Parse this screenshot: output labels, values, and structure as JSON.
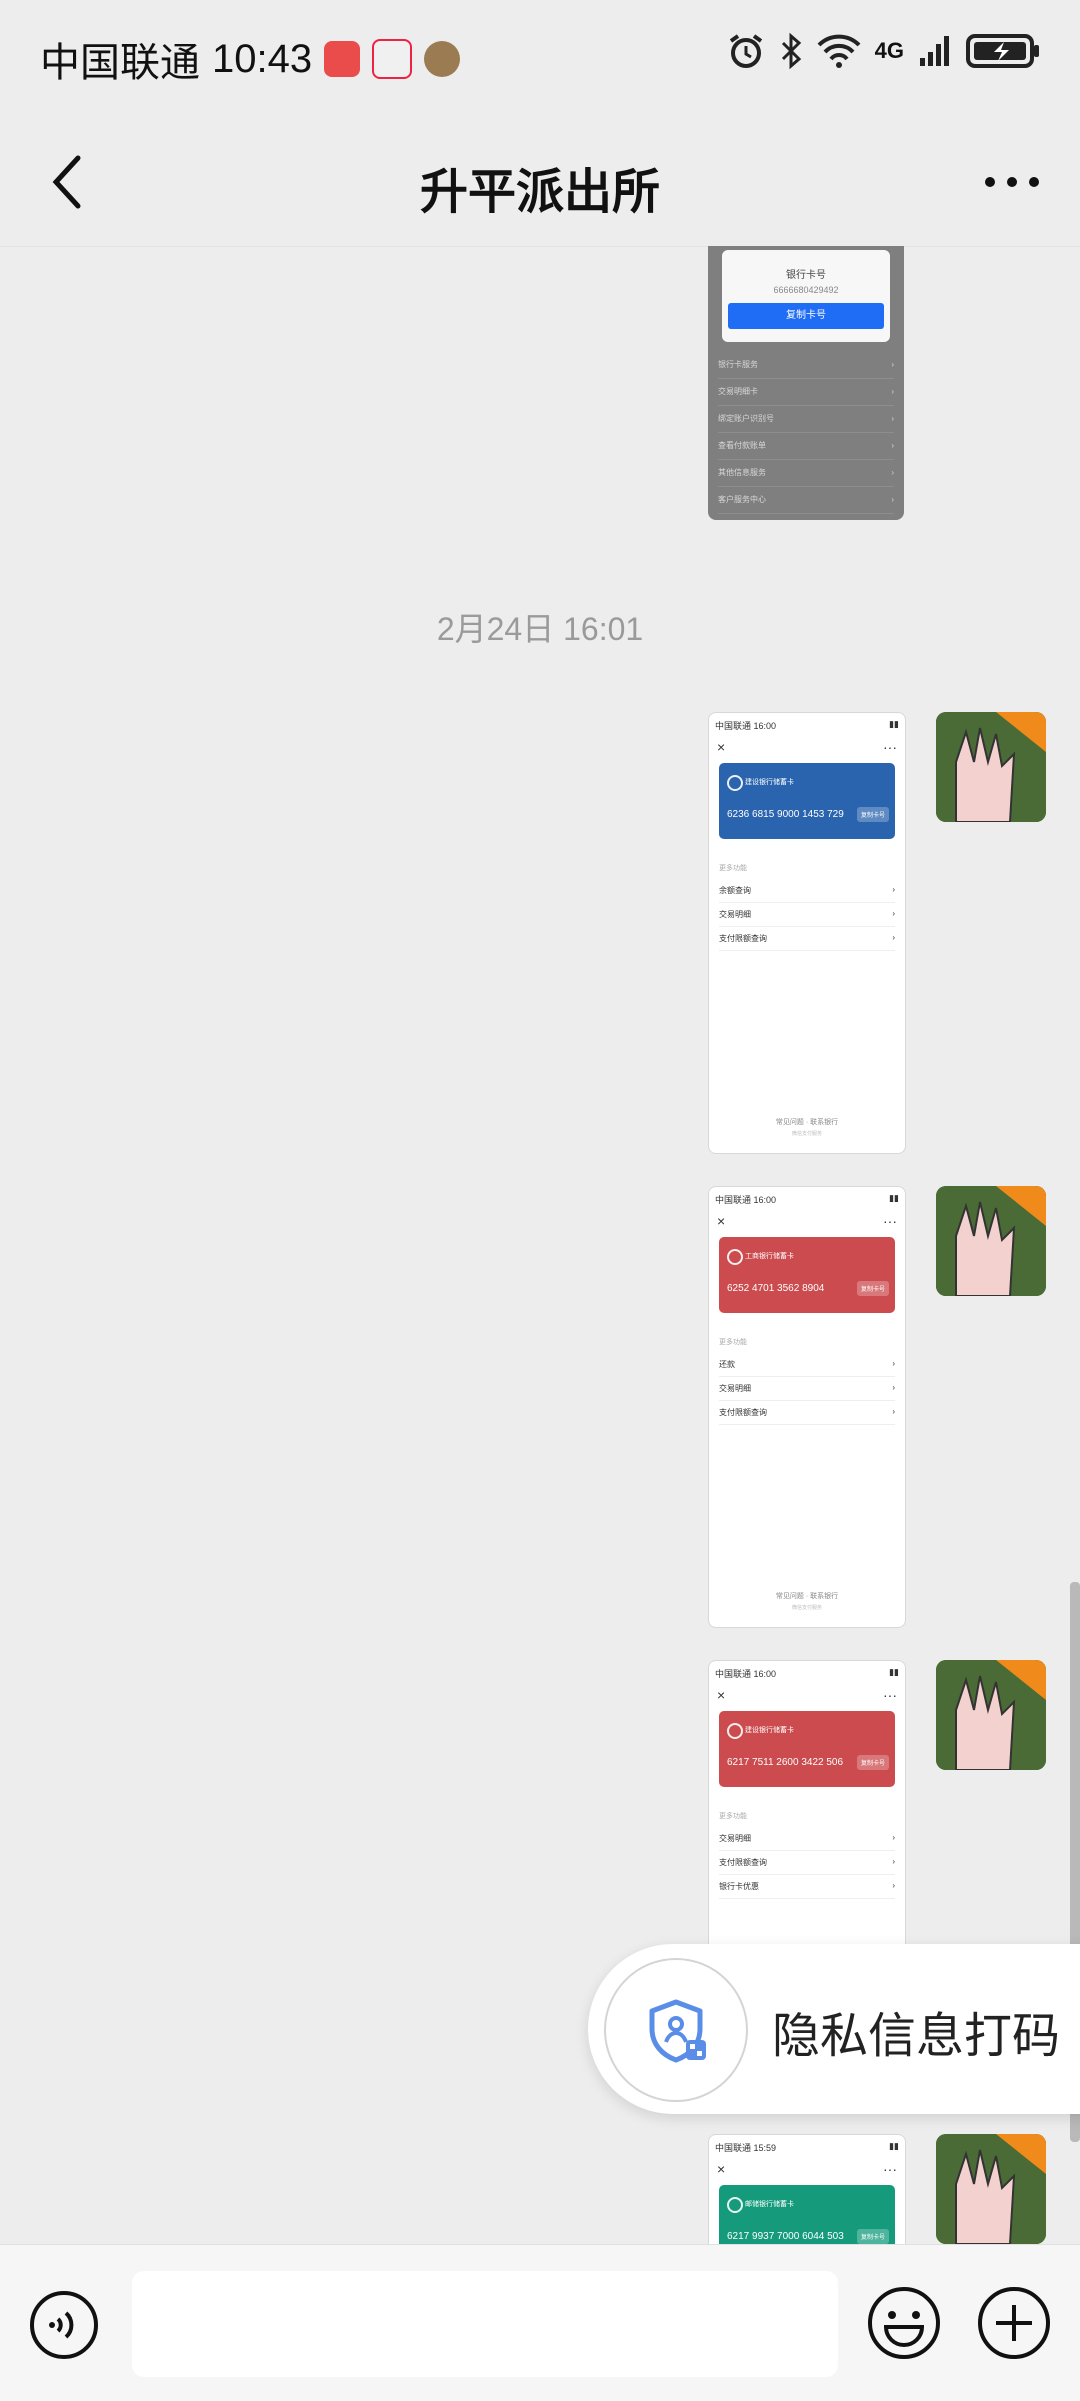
{
  "status_bar": {
    "carrier": "中国联通",
    "time": "10:43",
    "network": "4G"
  },
  "header": {
    "title": "升平派出所"
  },
  "chat": {
    "timestamp": "2月24日 16:01",
    "blurred_shot": {
      "popup_title": "银行卡号",
      "popup_number": "6666680429492",
      "popup_button": "复制卡号",
      "rows": [
        "银行卡服务",
        "交易明细卡",
        "绑定账户识别号",
        "查看付款账单",
        "其他信息服务",
        "客户服务中心"
      ]
    },
    "messages": [
      {
        "mini_time": "中国联通 16:00",
        "bank": "建设银行储蓄卡",
        "card_number": "6236 6815 9000 1453 729",
        "card_button": "复制卡号",
        "color": "#2a63ae",
        "section": "更多功能",
        "rows": [
          "余额查询",
          "交易明细",
          "支付限额查询"
        ],
        "footer": "常见问题 · 联系银行",
        "footer_sub": "微信支付服务"
      },
      {
        "mini_time": "中国联通 16:00",
        "bank": "工商银行储蓄卡",
        "card_number": "6252 4701 3562 8904",
        "card_button": "复制卡号",
        "color": "#cc4b4e",
        "section": "更多功能",
        "rows": [
          "还款",
          "交易明细",
          "支付限额查询"
        ],
        "footer": "常见问题 · 联系银行",
        "footer_sub": "微信支付服务"
      },
      {
        "mini_time": "中国联通 16:00",
        "bank": "建设银行储蓄卡",
        "card_number": "6217 7511 2600 3422 506",
        "card_button": "复制卡号",
        "color": "#cc4b4e",
        "section": "更多功能",
        "rows": [
          "交易明细",
          "支付限额查询",
          "银行卡优惠"
        ],
        "footer": "",
        "footer_sub": ""
      },
      {
        "mini_time": "中国联通 15:59",
        "bank": "邮储银行储蓄卡",
        "card_number": "6217 9937 7000 6044 503",
        "card_button": "复制卡号",
        "color": "#159b7c",
        "section": "",
        "rows": [],
        "footer": "",
        "footer_sub": ""
      }
    ]
  },
  "privacy_button": {
    "label": "隐私信息打码"
  },
  "colors": {
    "background": "#ededed",
    "accent": "#1f6cf5"
  },
  "icons": [
    "back-arrow-icon",
    "more-dots-icon",
    "voice-icon",
    "emoji-icon",
    "plus-icon",
    "privacy-shield-icon",
    "alarm-icon",
    "bluetooth-icon",
    "wifi-icon",
    "signal-icon",
    "battery-icon"
  ]
}
